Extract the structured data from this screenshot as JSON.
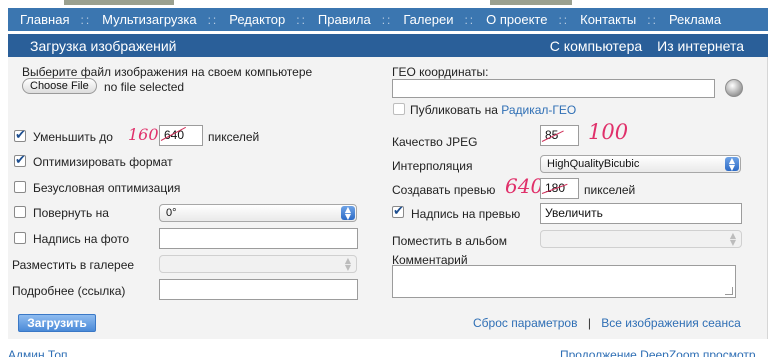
{
  "nav": {
    "items": [
      "Главная",
      "Мультизагрузка",
      "Редактор",
      "Правила",
      "Галереи",
      "О проекте",
      "Контакты",
      "Реклама"
    ],
    "separator": "::"
  },
  "subbar": {
    "title": "Загрузка изображений",
    "from_computer": "С компьютера",
    "from_internet": "Из интернета"
  },
  "left": {
    "choose_file_label": "Выберите файл изображения на своем компьютере",
    "choose_file_button": "Choose File",
    "no_file_text": "no file selected",
    "reduce_label": "Уменьшить до",
    "reduce_value": "640",
    "reduce_units": "пикселей",
    "optimize_format": "Оптимизировать формат",
    "unconditional_opt": "Безусловная оптимизация",
    "rotate_label": "Повернуть на",
    "rotate_value": "0°",
    "caption_label": "Надпись на фото",
    "gallery_label": "Разместить в галерее",
    "more_link_label": "Подробнее (ссылка)",
    "upload_button": "Загрузить"
  },
  "right": {
    "geo_label": "ГЕО координаты:",
    "publish_prefix": "Публиковать на",
    "publish_link": "Радикал-ГЕО",
    "jpeg_label": "Качество JPEG",
    "jpeg_value": "85",
    "interp_label": "Интерполяция",
    "interp_value": "HighQualityBicubic",
    "preview_label": "Создавать превью",
    "preview_value": "180",
    "preview_units": "пикселей",
    "preview_caption_label": "Надпись на превью",
    "preview_caption_value": "Увеличить",
    "album_label": "Поместить в альбом",
    "comment_label": "Комментарий",
    "reset_link": "Сброс параметров",
    "link_separator": "|",
    "all_images_link": "Все изображения сеанса"
  },
  "handwritten": {
    "reduce_note": "1600",
    "jpeg_note": "100",
    "preview_note": "640"
  },
  "footer": {
    "left": "Админ Топ",
    "right": "Продолжение  DeepZoom просмотр"
  },
  "colors": {
    "nav_bg": "#3b76b0",
    "subbar_bg": "#2a5f99",
    "panel_bg": "#f3f3f3",
    "link": "#2f6fb5",
    "handwriting": "#e0306a"
  },
  "icons": {
    "geo_picker": "globe-icon",
    "checkmark": "checkmark-icon",
    "select_arrow": "updown-arrow-icon"
  }
}
